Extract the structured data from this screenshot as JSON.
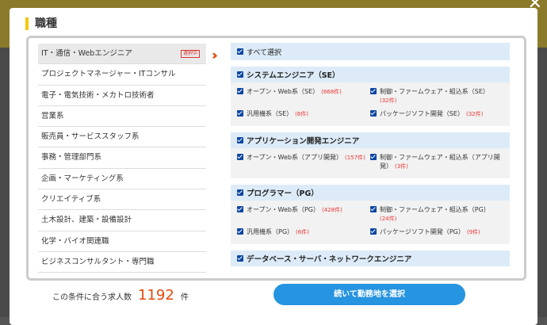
{
  "title": "職種",
  "categories": [
    {
      "label": "IT・通信・Webエンジニア",
      "selected": true,
      "tag": "選択中"
    },
    {
      "label": "プロジェクトマネージャー・ITコンサル"
    },
    {
      "label": "電子・電気技術・メカトロ技術者"
    },
    {
      "label": "営業系"
    },
    {
      "label": "販売員・サービススタッフ系"
    },
    {
      "label": "事務・管理部門系"
    },
    {
      "label": "企画・マーケティング系"
    },
    {
      "label": "クリエイティブ系"
    },
    {
      "label": "土木設計、建築・設備設計"
    },
    {
      "label": "化学・バイオ関連職"
    },
    {
      "label": "ビジネスコンサルタント・専門職"
    }
  ],
  "select_all": "すべて選択",
  "groups": [
    {
      "title": "システムエンジニア（SE）",
      "items": [
        {
          "label": "オープン・Web系（SE）",
          "count": "(668件)"
        },
        {
          "label": "制御・ファームウェア・組込系（SE）",
          "count": "(32件)"
        },
        {
          "label": "汎用機系（SE）",
          "count": "(6件)"
        },
        {
          "label": "パッケージソフト開発（SE）",
          "count": "(32件)"
        }
      ]
    },
    {
      "title": "アプリケーション開発エンジニア",
      "items": [
        {
          "label": "オープン・Web系（アプリ開発）",
          "count": "(157件)"
        },
        {
          "label": "制御・ファームウェア・組込系（アプリ開発）",
          "count": "(3件)"
        }
      ]
    },
    {
      "title": "プログラマー（PG）",
      "items": [
        {
          "label": "オープン・Web系（PG）",
          "count": "(428件)"
        },
        {
          "label": "制御・ファームウェア・組込系（PG）",
          "count": "(24件)"
        },
        {
          "label": "汎用機系（PG）",
          "count": "(6件)"
        },
        {
          "label": "パッケージソフト開発（PG）",
          "count": "(9件)"
        }
      ]
    },
    {
      "title": "データベース・サーバ・ネットワークエンジニア",
      "items": []
    }
  ],
  "footer": {
    "prefix": "この条件に合う求人数",
    "count": "1192",
    "suffix": "件"
  },
  "cta_label": "続いて勤務地を選択",
  "close_icon": "close-icon",
  "accent_color": "#e8470b",
  "button_color": "#2694e0"
}
